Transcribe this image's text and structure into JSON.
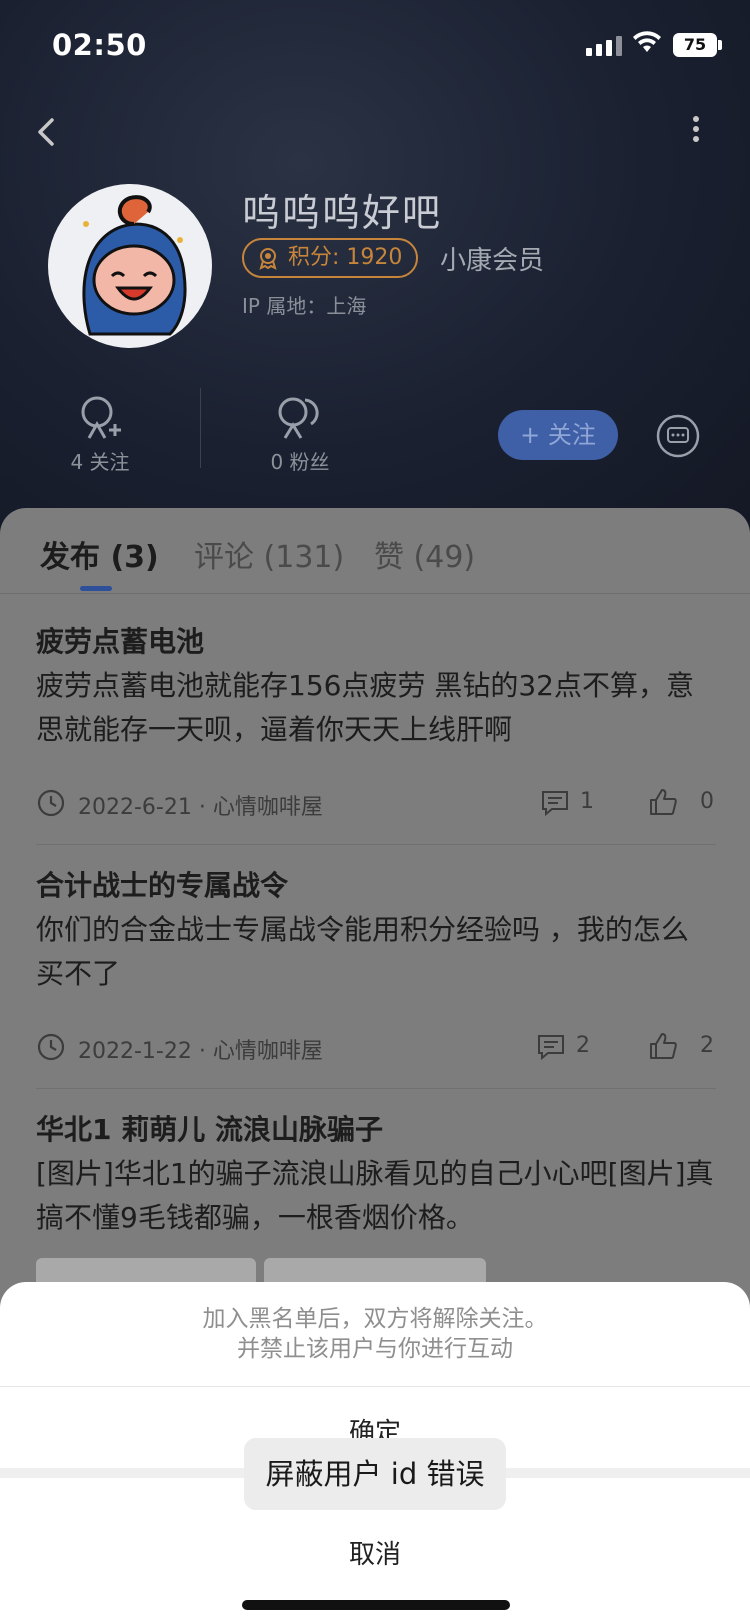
{
  "status_bar": {
    "time": "02:50",
    "battery": "75"
  },
  "profile": {
    "username": "呜呜呜好吧",
    "points_label": "积分: 1920",
    "member_level": "小康会员",
    "ip_location": "IP 属地：上海"
  },
  "stats": {
    "following_label": "4 关注",
    "followers_label": "0 粉丝"
  },
  "actions": {
    "follow_label": "+ 关注"
  },
  "tabs": [
    {
      "label": "发布 (3)",
      "active": true
    },
    {
      "label": "评论 (131)",
      "active": false
    },
    {
      "label": "赞 (49)",
      "active": false
    }
  ],
  "posts": [
    {
      "title": "疲劳点蓄电池",
      "body": "疲劳点蓄电池就能存156点疲劳 黑钻的32点不算，意思就能存一天呗，逼着你天天上线肝啊",
      "meta": "2022-6-21 · 心情咖啡屋",
      "comments": "1",
      "likes": "0"
    },
    {
      "title": "合计战士的专属战令",
      "body": "你们的合金战士专属战令能用积分经验吗 ，我的怎么买不了",
      "meta": "2022-1-22 · 心情咖啡屋",
      "comments": "2",
      "likes": "2"
    },
    {
      "title": "华北1 莉萌儿 流浪山脉骗子",
      "body": "[图片]华北1的骗子流浪山脉看见的自己小心吧[图片]真搞不懂9毛钱都骗，一根香烟价格。"
    }
  ],
  "action_sheet": {
    "message_line1": "加入黑名单后，双方将解除关注。",
    "message_line2": "并禁止该用户与你进行互动",
    "confirm_label": "确定",
    "cancel_label": "取消"
  },
  "toast": {
    "message": "屏蔽用户 id 错误"
  },
  "colors": {
    "accent": "#2e4f99",
    "badge": "#c7853b",
    "header_bg": "#1a2030"
  }
}
